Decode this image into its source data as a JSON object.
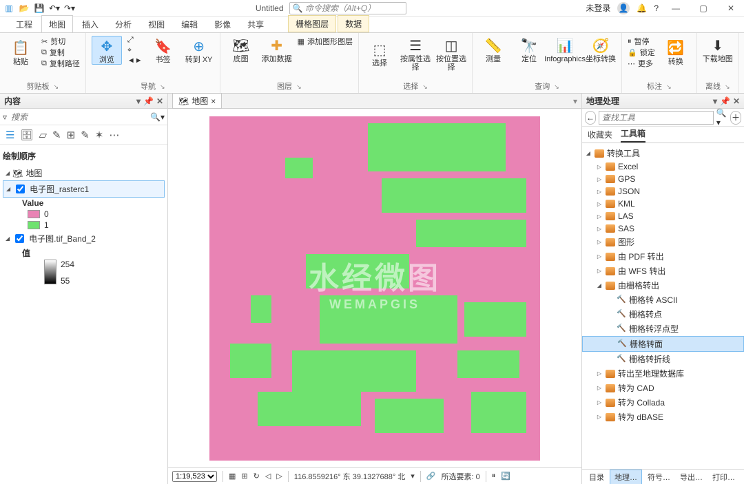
{
  "titlebar": {
    "title": "Untitled",
    "search_placeholder": "命令搜索（Alt+Q）",
    "login": "未登录"
  },
  "ribbon_tabs": [
    "工程",
    "地图",
    "插入",
    "分析",
    "视图",
    "编辑",
    "影像",
    "共享"
  ],
  "ribbon_tab_active": 1,
  "ribbon_ctx_tabs": [
    "栅格图层",
    "数据"
  ],
  "ribbon": {
    "clipboard": {
      "paste": "粘贴",
      "cut": "剪切",
      "copy": "复制",
      "copy_path": "复制路径",
      "label": "剪贴板"
    },
    "nav": {
      "browse": "浏览",
      "bookmark": "书签",
      "goto_xy": "转到\nXY",
      "label": "导航"
    },
    "layer": {
      "basemap": "底图",
      "add_data": "添加数据",
      "add_gfx": "添加图形图层",
      "label": "图层"
    },
    "select": {
      "select": "选择",
      "by_attr": "按属性选择",
      "by_loc": "按位置选择",
      "label": "选择"
    },
    "query": {
      "measure": "测量",
      "locate": "定位",
      "info": "Infographics",
      "coord": "坐标转换",
      "label": "查询"
    },
    "label": {
      "pause": "暂停",
      "lock": "锁定",
      "more": "更多",
      "convert": "转换",
      "label": "标注"
    },
    "offline": {
      "download": "下载地图",
      "label": "离线"
    }
  },
  "contents": {
    "title": "内容",
    "search_placeholder": "搜索",
    "order_hd": "绘制顺序",
    "map_name": "地图",
    "layer1": {
      "name": "电子图_rasterc1",
      "vals_label": "Value",
      "v0": "0",
      "v1": "1",
      "c0": "#e983b4",
      "c1": "#6fe26f"
    },
    "layer2": {
      "name": "电子图.tif_Band_2",
      "vals_label": "值",
      "hi": "254",
      "lo": "55"
    }
  },
  "map_tab": "地图",
  "watermark": {
    "cn": "水经微图",
    "en": "WEMAPGIS"
  },
  "status": {
    "scale": "1:19,523",
    "coords": "116.8559216° 东 39.1327688° 北",
    "sel": "所选要素: 0"
  },
  "gp": {
    "title": "地理处理",
    "search": "查找工具",
    "fav": "收藏夹",
    "box": "工具箱",
    "root": "转换工具",
    "sets": [
      "Excel",
      "GPS",
      "JSON",
      "KML",
      "LAS",
      "SAS",
      "图形",
      "由 PDF 转出",
      "由 WFS 转出"
    ],
    "open_set": "由栅格转出",
    "tools": [
      "栅格转 ASCII",
      "栅格转点",
      "栅格转浮点型",
      "栅格转面",
      "栅格转折线"
    ],
    "tool_selected": 3,
    "tail_sets": [
      "转出至地理数据库",
      "转为 CAD",
      "转为 Collada",
      "转为 dBASE"
    ]
  },
  "bottom_tabs": [
    "目录",
    "地理…",
    "符号…",
    "导出…",
    "打印…"
  ],
  "bottom_tab_active": 1
}
